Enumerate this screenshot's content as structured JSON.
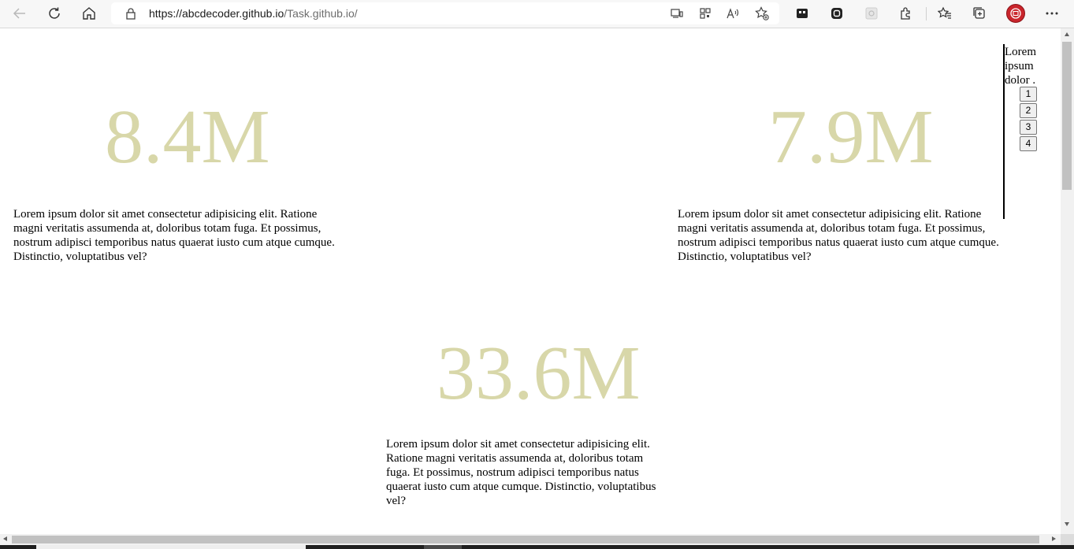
{
  "browser": {
    "url_host": "https://abcdecoder.github.io",
    "url_path": "/Task.github.io/"
  },
  "page": {
    "stats": [
      {
        "value": "8.4M",
        "text": "Lorem ipsum dolor sit amet consectetur adipisicing elit. Ratione magni veritatis assumenda at, doloribus totam fuga. Et possimus, nostrum adipisci temporibus natus quaerat iusto cum atque cumque. Distinctio, voluptatibus vel?"
      },
      {
        "value": "7.9M",
        "text": "Lorem ipsum dolor sit amet consectetur adipisicing elit. Ratione magni veritatis assumenda at, doloribus totam fuga. Et possimus, nostrum adipisci temporibus natus quaerat iusto cum atque cumque. Distinctio, voluptatibus vel?"
      },
      {
        "value": "33.6M",
        "text": "Lorem ipsum dolor sit amet consectetur adipisicing elit. Ratione magni veritatis assumenda at, doloribus totam fuga. Et possimus, nostrum adipisci temporibus natus quaerat iusto cum atque cumque. Distinctio, voluptatibus vel?"
      }
    ],
    "sidebar": {
      "text": "Lorem ipsum dolor .",
      "buttons": [
        "1",
        "2",
        "3",
        "4"
      ]
    }
  },
  "colors": {
    "stat_number": "#d8d7a9",
    "profile_red": "#c9252c"
  },
  "icons": [
    "back-icon",
    "refresh-icon",
    "home-icon",
    "lock-icon",
    "app-available-icon",
    "qr-code-icon",
    "read-aloud-icon",
    "add-favorite-icon",
    "tracking-icon",
    "extension-icon",
    "screenshot-icon",
    "puzzle-extensions-icon",
    "favorites-icon",
    "collections-icon",
    "profile-icon",
    "more-menu-icon"
  ]
}
